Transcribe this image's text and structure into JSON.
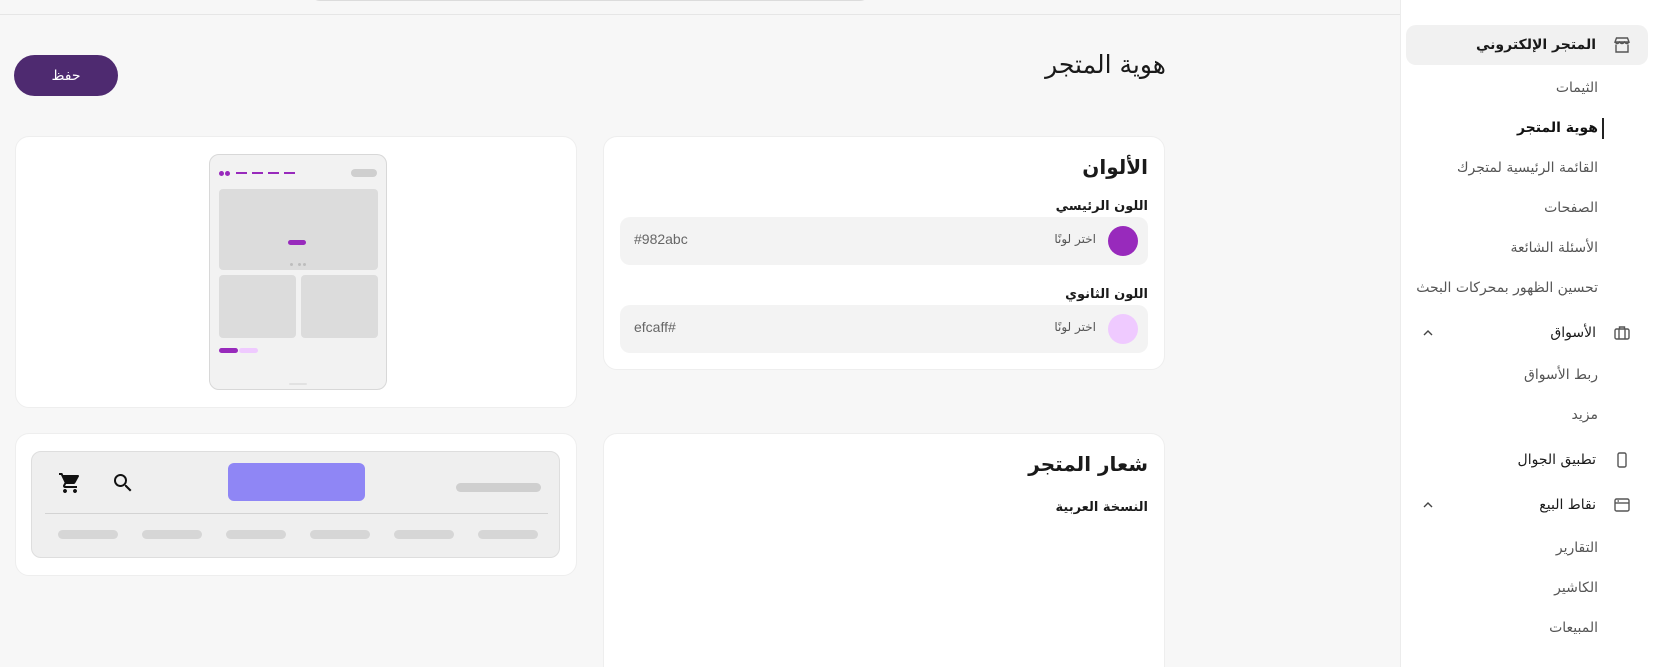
{
  "sidebar": {
    "store": "المتجر الإلكتروني",
    "themes": "الثيمات",
    "identity": "هوية المتجر",
    "main_menu": "القائمة الرئيسية لمتجرك",
    "pages": "الصفحات",
    "faq": "الأسئلة الشائعة",
    "seo": "تحسين الظهور بمحركات البحث",
    "markets": "الأسواق",
    "link_markets": "ربط الأسواق",
    "mazeed": "مزيد",
    "mobile_app": "تطبيق الجوال",
    "pos": "نقاط البيع",
    "reports": "التقارير",
    "cashier": "الكاشير",
    "sales": "المبيعات"
  },
  "page": {
    "title": "هوية المتجر",
    "save_label": "حفظ"
  },
  "colors_card": {
    "title": "الألوان",
    "primary_label": "اللون الرئيسي",
    "primary_pick": "اختر لونًا",
    "primary_hex": "#982abc",
    "secondary_label": "اللون الثانوي",
    "secondary_pick": "اختر لونًا",
    "secondary_hex": "efcaff#"
  },
  "logo_card": {
    "title": "شعار المتجر",
    "arabic_version": "النسخة العربية"
  },
  "palette": {
    "primary": "#982abc",
    "secondary": "#efcaff",
    "save_bg": "#4e2a70",
    "header_button": "#8f86f5"
  }
}
